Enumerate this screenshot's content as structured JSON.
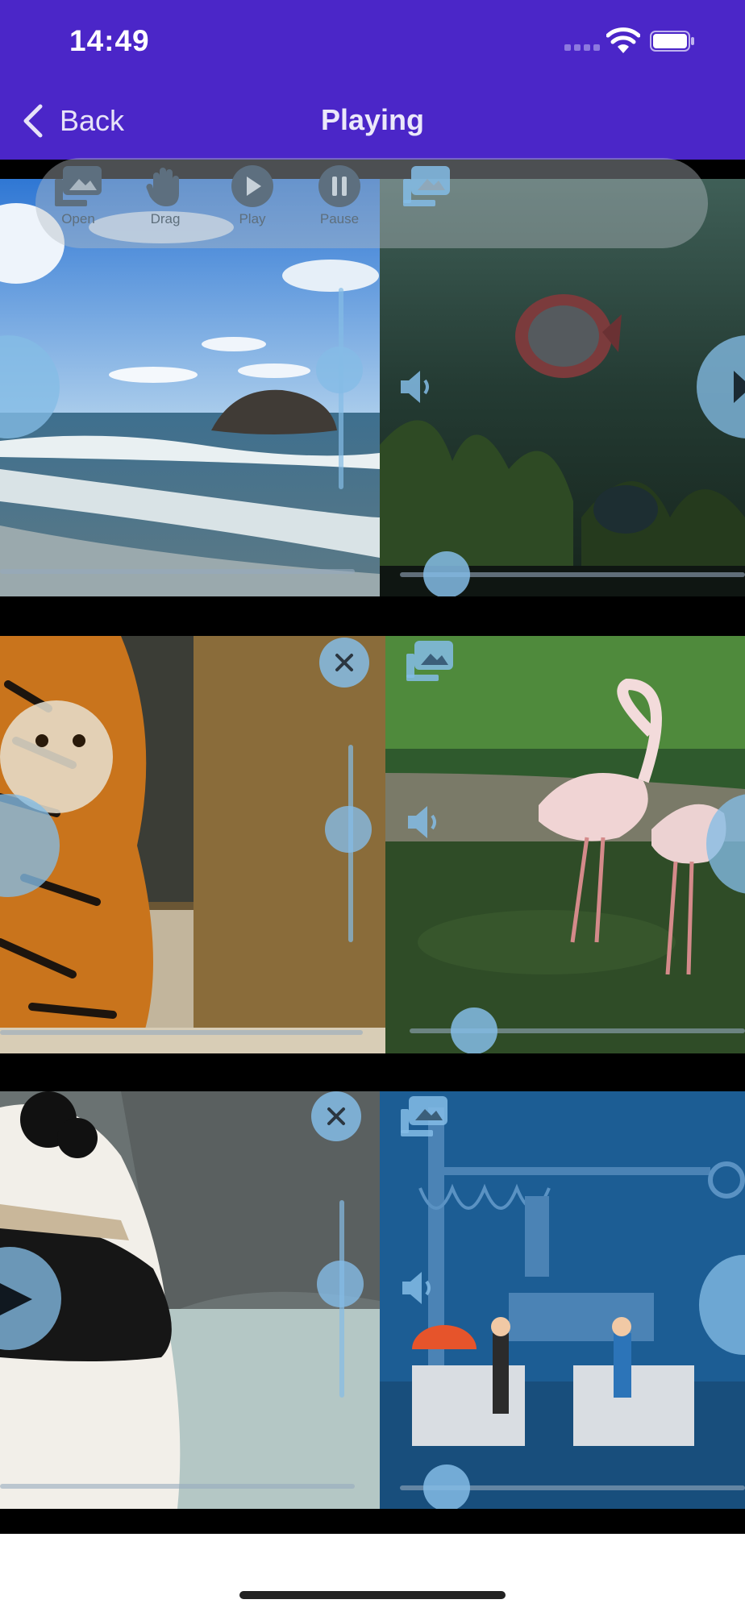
{
  "status_bar": {
    "time": "14:49",
    "icons": [
      "cellular-signal-icon",
      "wifi-icon",
      "battery-icon"
    ]
  },
  "nav": {
    "back_label": "Back",
    "title": "Playing",
    "background": "#4b26c8"
  },
  "toolbar": {
    "items": [
      {
        "label": "Open",
        "icon": "open-media-icon"
      },
      {
        "label": "Drag",
        "icon": "hand-icon"
      },
      {
        "label": "Play",
        "icon": "play-icon"
      },
      {
        "label": "Pause",
        "icon": "pause-icon"
      }
    ],
    "extra_icon": "media-gallery-icon"
  },
  "players": [
    {
      "scene": "ocean waves with a rock",
      "controls": [
        "play-button",
        "volume-slider",
        "progress-bar"
      ]
    },
    {
      "scene": "discus fish in aquarium",
      "controls": [
        "speaker-icon",
        "play-button",
        "progress-bar"
      ]
    },
    {
      "scene": "tiger",
      "controls": [
        "close-button",
        "play-button",
        "volume-slider",
        "progress-bar"
      ]
    },
    {
      "scene": "flamingos in water",
      "controls": [
        "media-icon",
        "speaker-icon",
        "play-button",
        "progress-bar"
      ]
    },
    {
      "scene": "giant panda",
      "controls": [
        "close-button",
        "play-button",
        "volume-slider",
        "progress-bar"
      ]
    },
    {
      "scene": "factory illustration",
      "controls": [
        "media-icon",
        "speaker-icon",
        "play-button",
        "progress-bar"
      ]
    }
  ],
  "colors": {
    "accent": "#4b26c8",
    "control": "#84bce6",
    "video_background": "#000000"
  }
}
